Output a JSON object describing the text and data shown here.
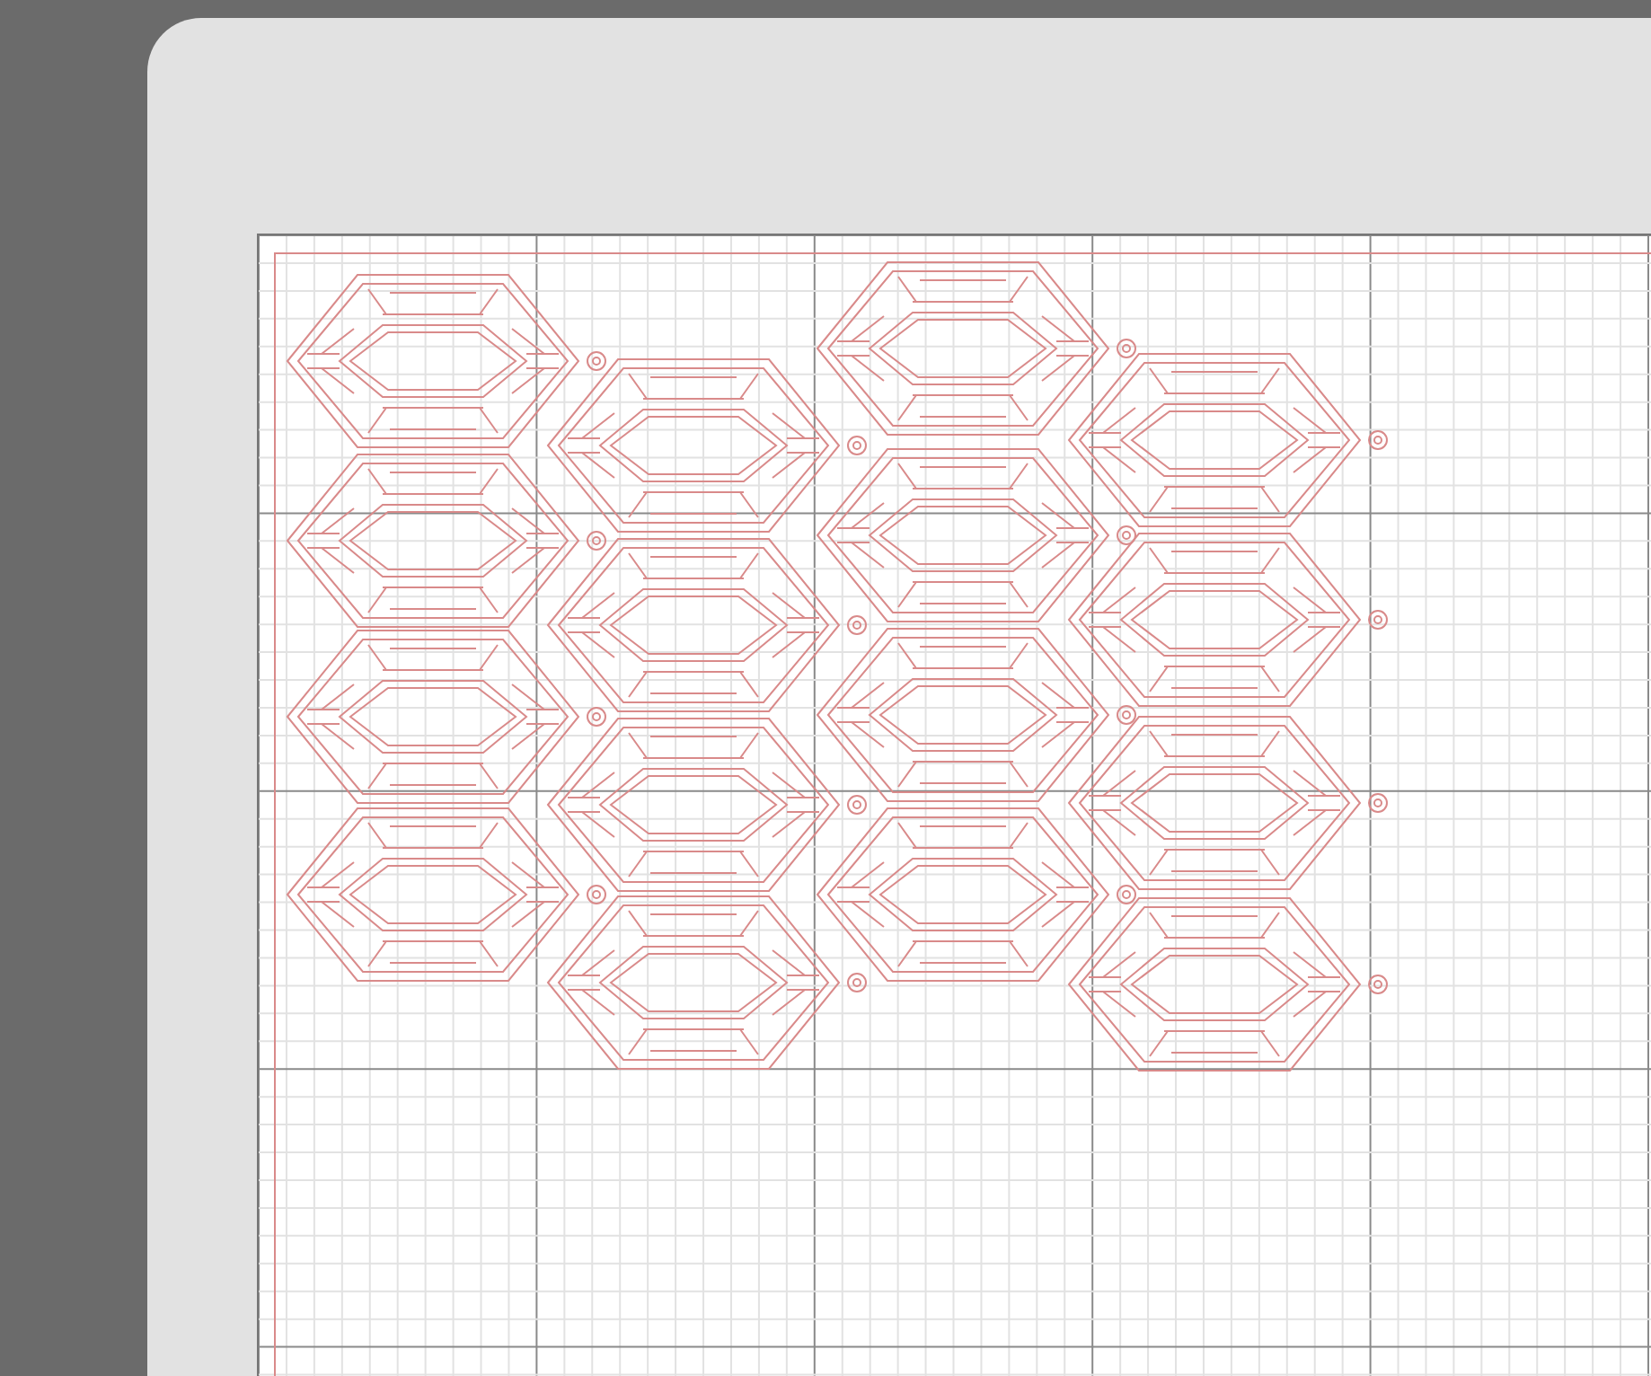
{
  "mat": {
    "kind": "grid"
  }
}
